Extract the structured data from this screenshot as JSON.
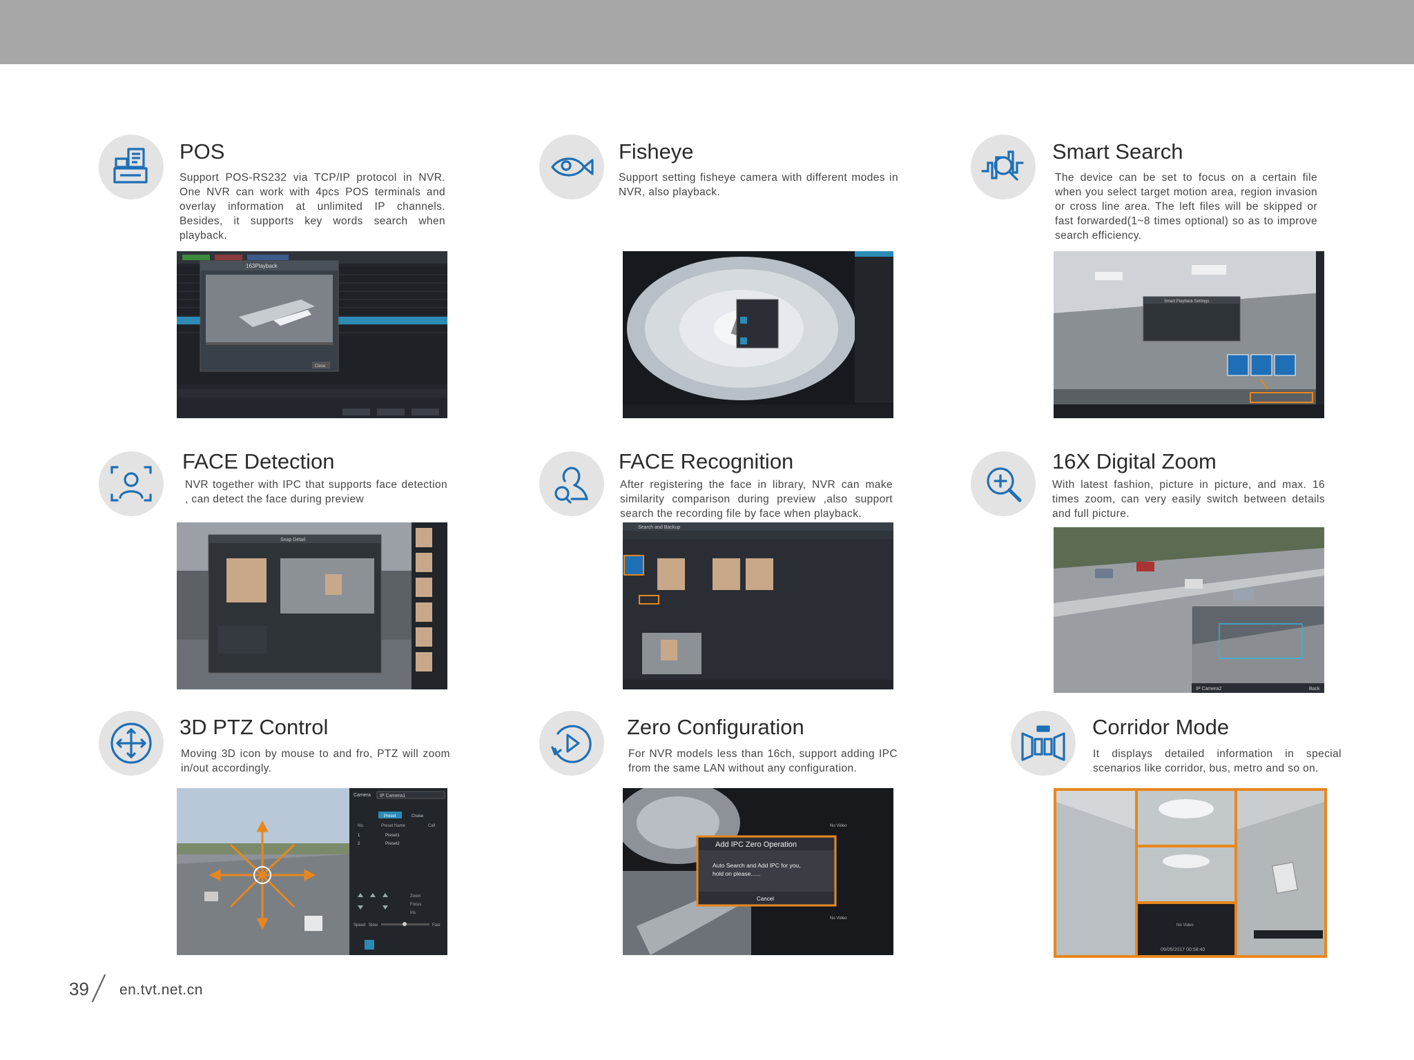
{
  "features": [
    {
      "title": "POS",
      "description": "Support POS-RS232 via TCP/IP protocol in NVR. One NVR can work with 4pcs POS terminals and overlay information at unlimited IP channels. Besides, it supports key words search when playback.",
      "icon": "pos-terminal-icon"
    },
    {
      "title": "Fisheye",
      "description": "Support setting fisheye camera with different modes in NVR, also playback.",
      "icon": "fisheye-icon"
    },
    {
      "title": "Smart Search",
      "description": "The device can be set to focus on a certain file when you select target motion area, region invasion or cross line area. The left files will be skipped or fast forwarded(1~8 times optional) so as to improve search efficiency.",
      "icon": "smart-search-icon"
    },
    {
      "title": "FACE Detection",
      "description": "NVR together with IPC that supports face detection , can detect the face during preview",
      "icon": "face-detection-icon"
    },
    {
      "title": "FACE Recognition",
      "description": "After registering the face in library, NVR can make similarity comparison during preview ,also support search the recording file by face when playback.",
      "icon": "face-recognition-icon"
    },
    {
      "title": "16X Digital Zoom",
      "description": "With latest fashion, picture in picture, and max. 16 times zoom, can very easily switch between details and full picture.",
      "icon": "zoom-in-icon"
    },
    {
      "title": "3D PTZ Control",
      "description": "Moving 3D icon by mouse to and fro, PTZ will zoom in/out accordingly.",
      "icon": "ptz-move-icon"
    },
    {
      "title": "Zero Configuration",
      "description": "For NVR models less than 16ch, support adding IPC from the same LAN without any configuration.",
      "icon": "zero-config-icon"
    },
    {
      "title": "Corridor Mode",
      "description": "It displays detailed information in special scenarios like corridor, bus, metro and so on.",
      "icon": "corridor-icon"
    }
  ],
  "screens": {
    "pos": {
      "dialog_title": "163Playback",
      "button": "Close"
    },
    "smart": {
      "dialog_title": "Smart Playback Settings"
    },
    "face_detect": {
      "dialog_title": "Snap Detail"
    },
    "face_recog": {
      "header": "Search and Backup"
    },
    "zoom": {
      "camera_label": "IP Camera2",
      "back": "Back"
    },
    "ptz": {
      "camera_label": "Camera",
      "camera_value": "IP Camera1",
      "tab_preset": "Preset",
      "tab_cruise": "Cruise",
      "col_no": "No.",
      "col_name": "Preset Name",
      "col_call": "Call",
      "presets": [
        "Preset1",
        "Preset2"
      ],
      "zoom": "Zoom",
      "focus": "Focus",
      "iris": "Iris",
      "speed": "Speed",
      "slow": "Slow",
      "fast": "Fast"
    },
    "zero": {
      "dialog_title": "Add IPC Zero Operation",
      "dialog_text_1": "Auto Search and Add IPC for you,",
      "dialog_text_2": "hold on please......",
      "cancel": "Cancel",
      "no_video": "No Video"
    },
    "corridor": {
      "no_video": "No Video",
      "timestamp": "09/05/2017 00:58:40"
    }
  },
  "footer": {
    "page_number": "39",
    "url": "en.tvt.net.cn"
  }
}
